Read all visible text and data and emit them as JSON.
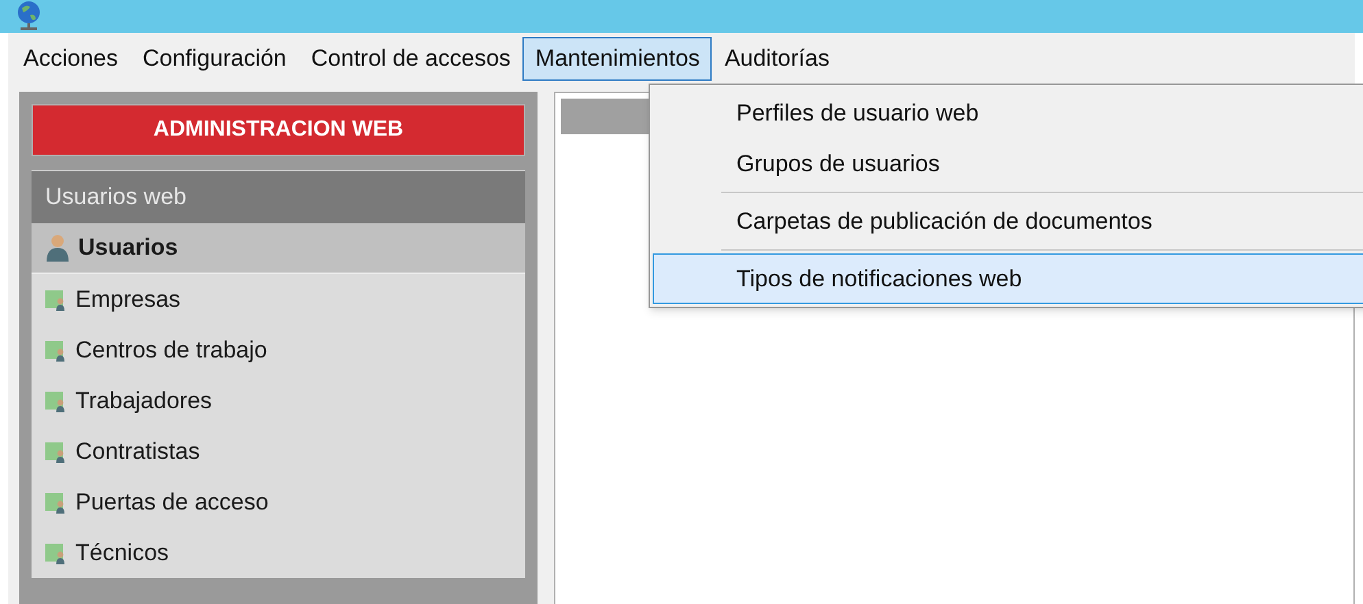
{
  "menu_bar": [
    {
      "label": "Acciones",
      "selected": false
    },
    {
      "label": "Configuración",
      "selected": false
    },
    {
      "label": "Control de accesos",
      "selected": false
    },
    {
      "label": "Mantenimientos",
      "selected": true
    },
    {
      "label": "Auditorías",
      "selected": false
    }
  ],
  "dropdown": [
    {
      "label": "Perfiles de usuario web",
      "selected": false,
      "separator_before": false
    },
    {
      "label": "Grupos de usuarios",
      "selected": false,
      "separator_before": false
    },
    {
      "label": "Carpetas de publicación de documentos",
      "selected": false,
      "separator_before": true
    },
    {
      "label": "Tipos de notificaciones web",
      "selected": true,
      "separator_before": true
    }
  ],
  "sidebar": {
    "title": "ADMINISTRACION WEB",
    "section": "Usuarios web",
    "items": [
      {
        "label": "Usuarios",
        "selected": true
      },
      {
        "label": "Empresas",
        "selected": false
      },
      {
        "label": "Centros de trabajo",
        "selected": false
      },
      {
        "label": "Trabajadores",
        "selected": false
      },
      {
        "label": "Contratistas",
        "selected": false
      },
      {
        "label": "Puertas de acceso",
        "selected": false
      },
      {
        "label": "Técnicos",
        "selected": false
      }
    ]
  }
}
